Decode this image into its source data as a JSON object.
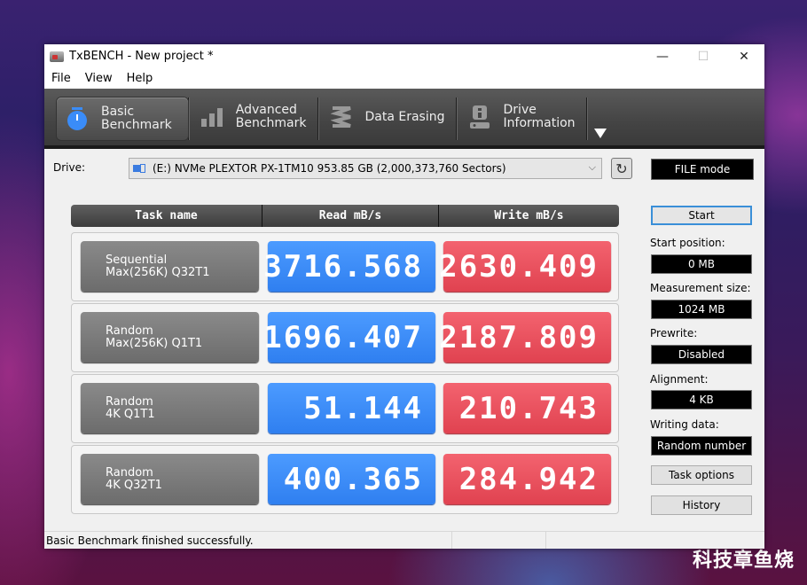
{
  "window": {
    "title": "TxBENCH - New project *",
    "controls": {
      "minimize": "—",
      "maximize": "☐",
      "close": "✕"
    }
  },
  "menu": [
    "File",
    "View",
    "Help"
  ],
  "toolbar": {
    "tabs": [
      {
        "line1": "Basic",
        "line2": "Benchmark",
        "icon": "stopwatch-icon",
        "active": true
      },
      {
        "line1": "Advanced",
        "line2": "Benchmark",
        "icon": "bar-chart-icon",
        "active": false
      },
      {
        "line1": "Data Erasing",
        "line2": "",
        "icon": "eraser-icon",
        "active": false
      },
      {
        "line1": "Drive",
        "line2": "Information",
        "icon": "drive-info-icon",
        "active": false
      }
    ]
  },
  "drive": {
    "label": "Drive:",
    "selected": "(E:) NVMe PLEXTOR PX-1TM10  953.85 GB (2,000,373,760 Sectors)",
    "chevron": "⌵",
    "refresh_glyph": "↻",
    "mode": "FILE mode"
  },
  "grid": {
    "headers": [
      "Task name",
      "Read mB/s",
      "Write mB/s"
    ],
    "rows": [
      {
        "line1": "Sequential",
        "line2": "Max(256K) Q32T1",
        "read": "3716.568",
        "write": "2630.409"
      },
      {
        "line1": "Random",
        "line2": "Max(256K) Q1T1",
        "read": "1696.407",
        "write": "2187.809"
      },
      {
        "line1": "Random",
        "line2": "4K Q1T1",
        "read": "51.144",
        "write": "210.743"
      },
      {
        "line1": "Random",
        "line2": "4K Q32T1",
        "read": "400.365",
        "write": "284.942"
      }
    ]
  },
  "side": {
    "start": "Start",
    "start_position_label": "Start position:",
    "start_position": "0 MB",
    "measurement_size_label": "Measurement size:",
    "measurement_size": "1024 MB",
    "prewrite_label": "Prewrite:",
    "prewrite": "Disabled",
    "alignment_label": "Alignment:",
    "alignment": "4 KB",
    "writing_data_label": "Writing data:",
    "writing_data": "Random number",
    "task_options": "Task options",
    "history": "History"
  },
  "status": {
    "message": "Basic Benchmark finished successfully."
  },
  "colors": {
    "read": "#3a8cf8",
    "write": "#ea505d",
    "accent": "#3a8fd8"
  },
  "watermark": "科技章鱼烧"
}
